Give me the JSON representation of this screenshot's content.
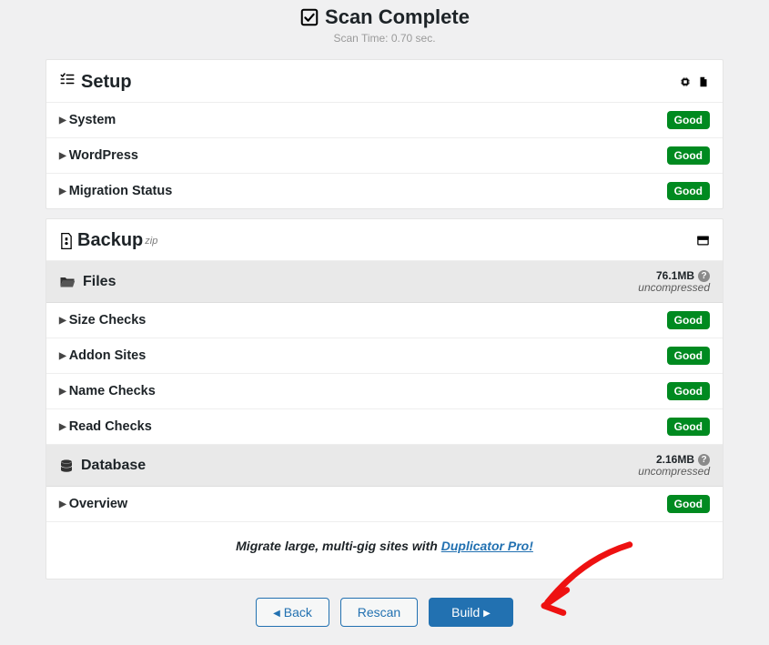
{
  "header": {
    "title": "Scan Complete",
    "sub": "Scan Time: 0.70 sec."
  },
  "setup": {
    "title": "Setup",
    "rows": [
      {
        "label": "System",
        "status": "Good"
      },
      {
        "label": "WordPress",
        "status": "Good"
      },
      {
        "label": "Migration Status",
        "status": "Good"
      }
    ]
  },
  "backup": {
    "title": "Backup",
    "format": "zip",
    "files": {
      "title": "Files",
      "size": "76.1MB",
      "note": "uncompressed",
      "rows": [
        {
          "label": "Size Checks",
          "status": "Good"
        },
        {
          "label": "Addon Sites",
          "status": "Good"
        },
        {
          "label": "Name Checks",
          "status": "Good"
        },
        {
          "label": "Read Checks",
          "status": "Good"
        }
      ]
    },
    "database": {
      "title": "Database",
      "size": "2.16MB",
      "note": "uncompressed",
      "rows": [
        {
          "label": "Overview",
          "status": "Good"
        }
      ]
    }
  },
  "promo": {
    "pre": "Migrate large, multi-gig sites with ",
    "link": "Duplicator Pro!"
  },
  "footer": {
    "back": "Back",
    "rescan": "Rescan",
    "build": "Build"
  }
}
